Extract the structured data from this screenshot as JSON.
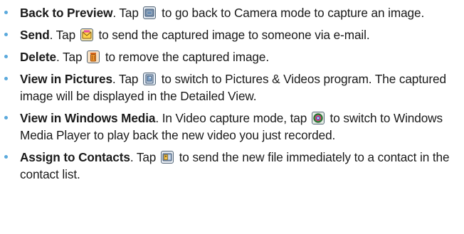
{
  "items": [
    {
      "title": "Back to Preview",
      "before": ". Tap ",
      "icon": "camera-preview-icon",
      "after": " to go back to Camera mode to capture an image."
    },
    {
      "title": "Send",
      "before": ". Tap ",
      "icon": "envelope-icon",
      "after": " to send the captured image to someone via e-mail."
    },
    {
      "title": "Delete",
      "before": ". Tap ",
      "icon": "trash-icon",
      "after": " to remove the captured image."
    },
    {
      "title": "View in Pictures",
      "before": ". Tap ",
      "icon": "pictures-icon",
      "after": " to switch to Pictures & Videos program. The captured image will be displayed in the Detailed View."
    },
    {
      "title": "View in Windows Media",
      "before": ". In Video capture mode, tap ",
      "icon": "media-player-icon",
      "after": " to switch to Windows Media Player to play back the new video you just recorded."
    },
    {
      "title": "Assign to Contacts",
      "before": ". Tap ",
      "icon": "contact-card-icon",
      "after": " to send the new file immediately to a contact in the contact list."
    }
  ],
  "colors": {
    "bullet": "#5aa9dc",
    "text": "#1a1a1a"
  }
}
